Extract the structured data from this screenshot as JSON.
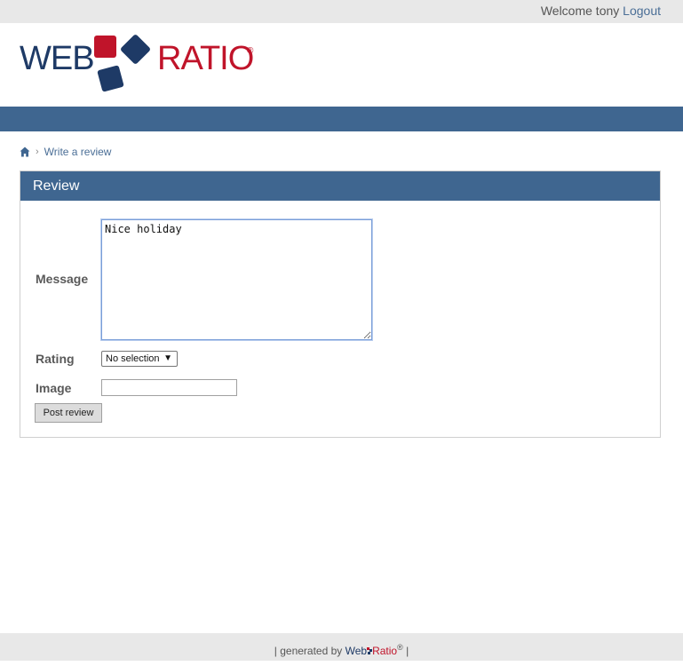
{
  "header": {
    "welcome_text": "Welcome tony",
    "logout_label": "Logout"
  },
  "logo": {
    "word_left": "WEB",
    "word_right": "RATIO",
    "registered": "®",
    "color_blue": "#1e3a66",
    "color_red": "#c0142a"
  },
  "breadcrumb": {
    "separator": "›",
    "current_label": "Write a review"
  },
  "panel": {
    "title": "Review"
  },
  "form": {
    "message_label": "Message",
    "message_value": "Nice holiday",
    "rating_label": "Rating",
    "rating_selected": "No selection",
    "image_label": "Image",
    "image_value": "",
    "submit_label": "Post review"
  },
  "footer": {
    "prefix": "| generated by",
    "brand_web": "Web",
    "brand_ratio": "Ratio",
    "registered": "®",
    "suffix": "|"
  },
  "colors": {
    "accent": "#3f6690",
    "link": "#4a6e96",
    "bar_gray": "#e8e8e8"
  }
}
